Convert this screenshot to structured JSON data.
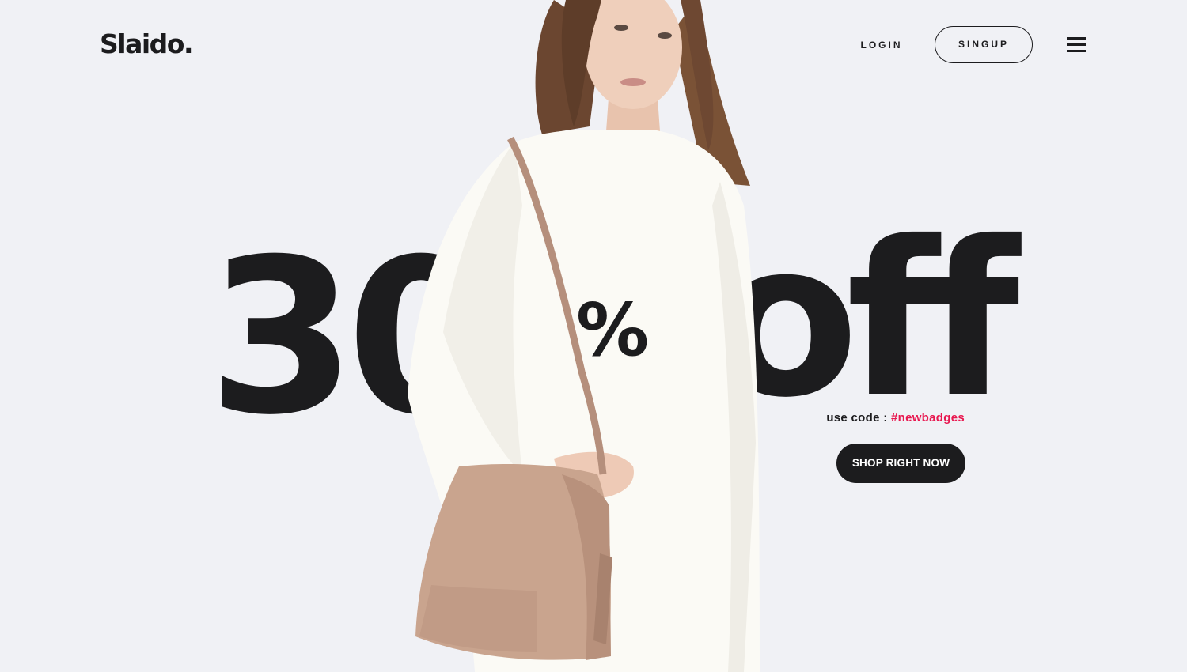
{
  "brand": {
    "logo": "Slaido."
  },
  "nav": {
    "login_label": "LOGIN",
    "signup_label": "SINGUP",
    "menu_icon": "hamburger-menu-icon"
  },
  "hero": {
    "number": "30",
    "percent": "%",
    "off": "off",
    "code_prefix": "use code : ",
    "code": "#newbadges",
    "cta_label": "SHOP RIGHT NOW"
  },
  "colors": {
    "background": "#f0f1f5",
    "text": "#1c1c1e",
    "accent": "#e8174f",
    "button_bg": "#1c1c1e",
    "button_text": "#ffffff"
  }
}
